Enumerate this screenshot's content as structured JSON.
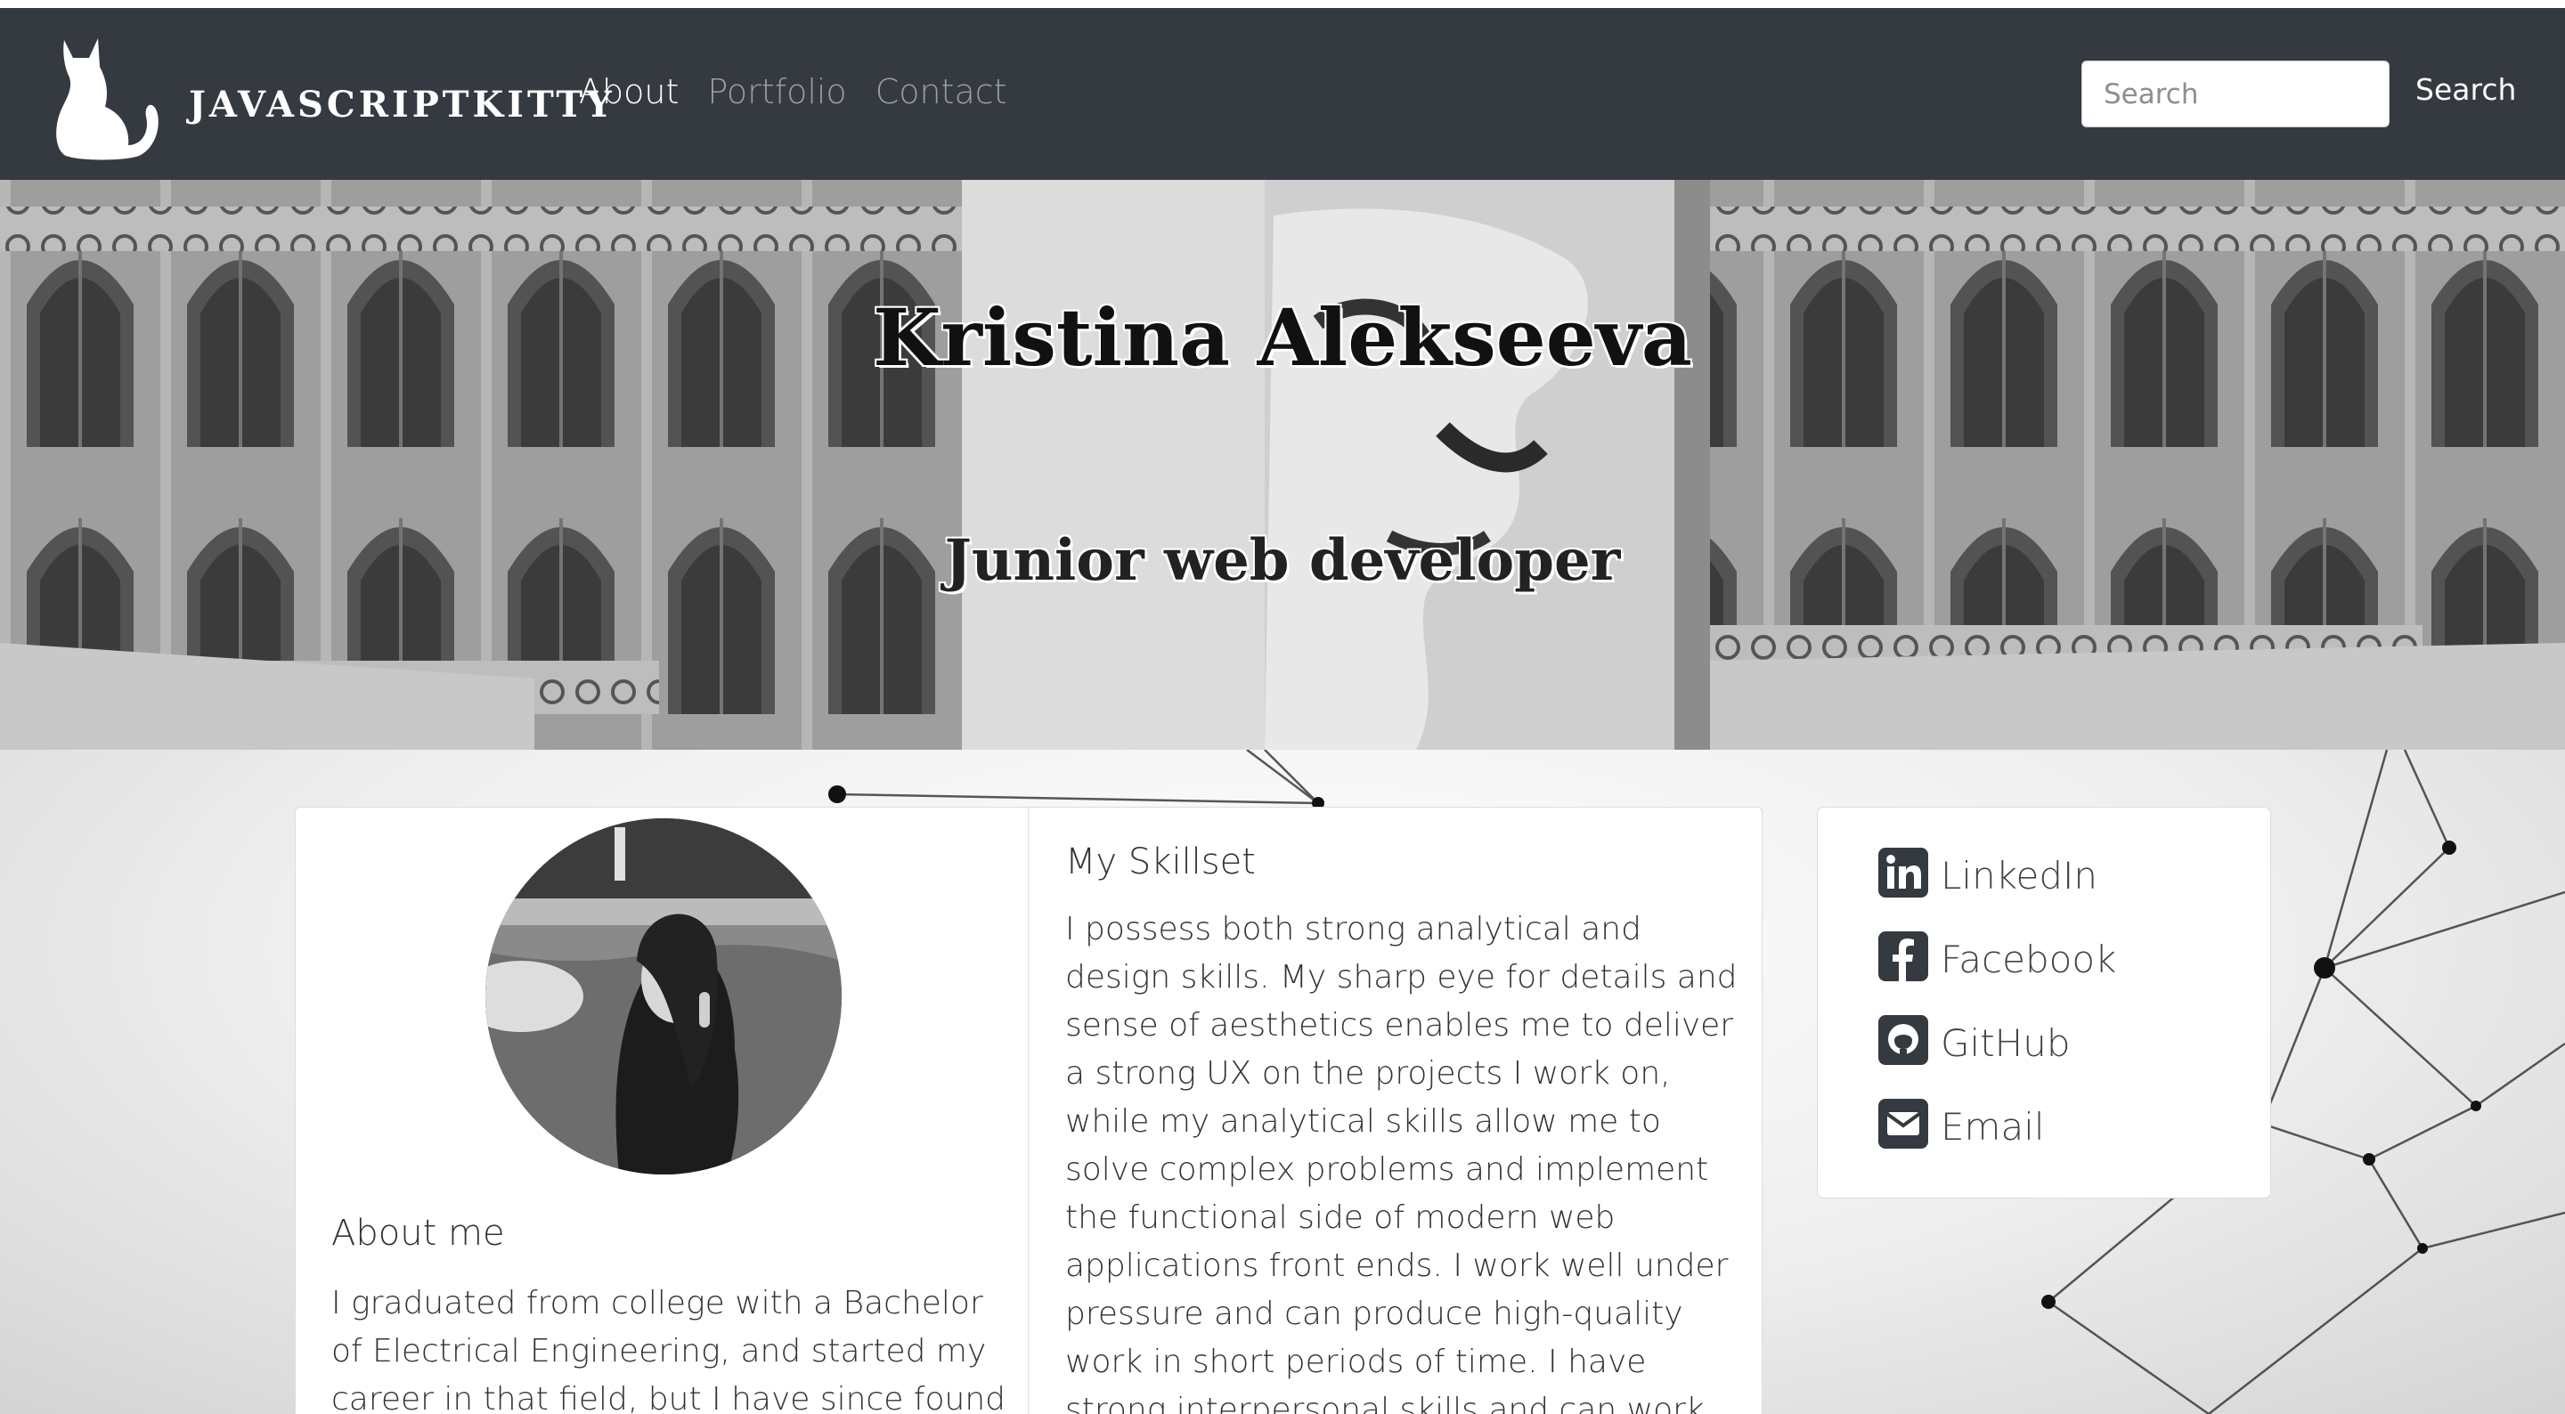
{
  "navbar": {
    "brand": "JAVASCRIPTKITTY",
    "links": [
      {
        "label": "About",
        "active": true
      },
      {
        "label": "Portfolio",
        "active": false
      },
      {
        "label": "Contact",
        "active": false
      }
    ],
    "search": {
      "placeholder": "Search",
      "value": ""
    },
    "search_button": "Search"
  },
  "hero": {
    "title": "Kristina Alekseeva",
    "subtitle": "Junior web developer"
  },
  "about": {
    "title": "About me",
    "text": "I graduated from college with a Bachelor of Electrical Engineering, and started my career in that field, but I have since found"
  },
  "skills": {
    "title": "My Skillset",
    "text": "I possess both strong analytical and design skills. My sharp eye for details and sense of aesthetics enables me to deliver a strong UX on the projects I work on, while my analytical skills allow me to solve complex problems and implement the functional side of modern web applications front ends. I work well under pressure and can produce high-quality work in short periods of time. I have strong interpersonal skills and can work with a wide variety of people."
  },
  "social": [
    {
      "label": "LinkedIn",
      "icon": "linkedin-icon"
    },
    {
      "label": "Facebook",
      "icon": "facebook-icon"
    },
    {
      "label": "GitHub",
      "icon": "github-icon"
    },
    {
      "label": "Email",
      "icon": "email-icon"
    }
  ],
  "colors": {
    "navbar": "#343a40",
    "nav_active": "#ffffff",
    "nav_inactive": "#9a9ea3",
    "card_border": "#dcdcdc",
    "icon": "#343a40"
  }
}
